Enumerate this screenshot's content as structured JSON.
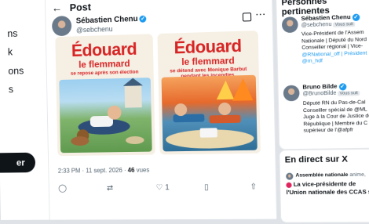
{
  "nav": {
    "items": [
      "ns",
      "k",
      "ons",
      "s"
    ],
    "post_button": "er"
  },
  "main": {
    "header_title": "Post",
    "author": {
      "name": "Sébastien Chenu",
      "handle": "@sebchenu"
    },
    "cards": [
      {
        "line1": "Édouard",
        "line2": "le flemmard",
        "line3": "se repose après son élection"
      },
      {
        "line1": "Édouard",
        "line2": "le flemmard",
        "line3": "se détend avec Monique Barbut pendant les incendies."
      }
    ],
    "meta": {
      "time": "2:33 PM · 11 sept. 2026 ·",
      "views_count": "46",
      "views_label": "vues"
    },
    "actions": {
      "likes": "1"
    }
  },
  "sidebar": {
    "relevant_title": "Personnes pertinentes",
    "follows_badge": "Vous suit",
    "people": [
      {
        "name": "Sébastien Chenu",
        "handle": "@sebchenu",
        "bio": [
          "Vice-Président de l'Assem",
          "Nationale | Député du Nord",
          "Conseiller régional | Vice-",
          "@RNational_off | Président",
          "@rn_hdf"
        ]
      },
      {
        "name": "Bruno Bilde",
        "handle": "@BrunoBilde",
        "bio": [
          "Député RN du Pas-de-Cal",
          "Conseiller spécial de @ML",
          "Juge à la Cour de Justice de",
          "République | Membre du C",
          "supérieur de l'@afpfr"
        ]
      }
    ],
    "live_title": "En direct sur X",
    "live": {
      "author": "Assemblée nationale",
      "suffix": "anime,",
      "text_line1": "La vice-présidente de",
      "text_line2": "l'Union nationale des CCAS s..."
    }
  },
  "colors": {
    "accent": "#1d9bf0",
    "title_red": "#d72525",
    "text": "#0f1419",
    "muted": "#536471"
  }
}
